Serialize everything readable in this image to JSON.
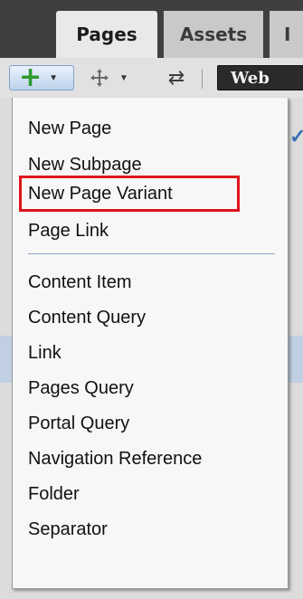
{
  "tabs": [
    "Pages",
    "Assets",
    "I"
  ],
  "toolbar": {
    "add_icon": "plus-icon",
    "move_icon": "move-icon",
    "refresh_icon": "refresh-icon",
    "web_label": "Web"
  },
  "menu": {
    "group1": [
      "New Page",
      "New Subpage",
      "New Page Variant",
      "Page Link"
    ],
    "group2": [
      "Content Item",
      "Content Query",
      "Link",
      "Pages Query",
      "Portal Query",
      "Navigation Reference",
      "Folder",
      "Separator"
    ],
    "highlighted_item": "New Page Variant",
    "highlight_color": "#e0131c"
  },
  "colors": {
    "add_plus": "#2e9a2e",
    "divider": "#8aa3c6"
  }
}
